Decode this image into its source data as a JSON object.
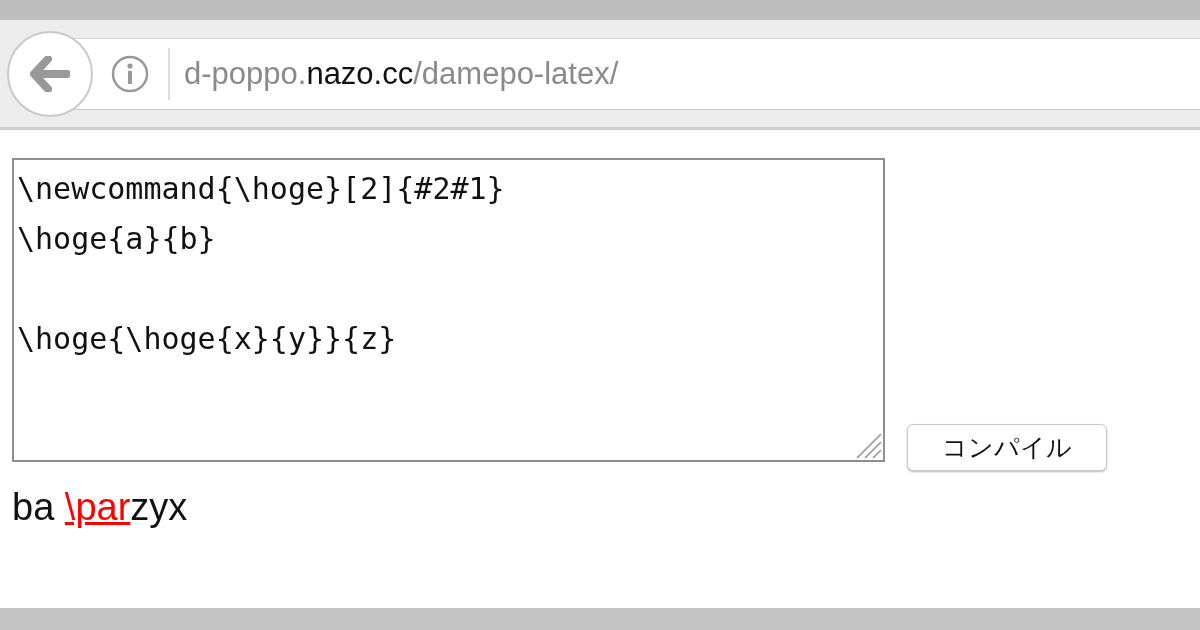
{
  "address_bar": {
    "url_prefix": "d-poppo.",
    "url_domain": "nazo.cc",
    "url_path": "/damepo-latex/"
  },
  "editor": {
    "value": "\\newcommand{\\hoge}[2]{#2#1}\n\\hoge{a}{b}\n\n\\hoge{\\hoge{x}{y}}{z}"
  },
  "compile_button": {
    "label": "コンパイル"
  },
  "output": {
    "before": "ba ",
    "error": "\\par",
    "after": "zyx"
  }
}
